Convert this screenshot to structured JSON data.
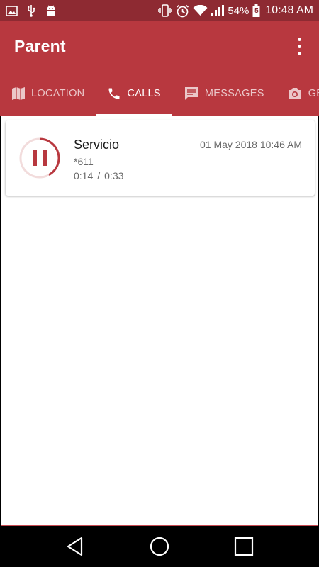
{
  "status_bar": {
    "battery": "54%",
    "time": "10:48 AM",
    "battery_digit": "5",
    "icons": [
      "image-icon",
      "usb-icon",
      "android-debug-icon",
      "vibrate-icon",
      "alarm-icon",
      "wifi-icon",
      "signal-icon",
      "battery-icon"
    ]
  },
  "app_bar": {
    "title": "Parent",
    "menu_icon": "more-vert-icon"
  },
  "tabs": [
    {
      "label": "LOCATION",
      "icon": "map-icon",
      "active": false
    },
    {
      "label": "CALLS",
      "icon": "phone-icon",
      "active": true
    },
    {
      "label": "MESSAGES",
      "icon": "message-icon",
      "active": false
    },
    {
      "label": "GET",
      "icon": "camera-icon",
      "active": false
    }
  ],
  "calls": [
    {
      "name": "Servicio",
      "number": "*611",
      "datetime": "01 May 2018 10:46 AM",
      "elapsed": "0:14",
      "separator": "/",
      "duration": "0:33",
      "progress_fraction": 0.42,
      "control_icon": "pause-icon"
    }
  ],
  "colors": {
    "status_bar": "#8e2a32",
    "primary": "#b8383f",
    "accent": "#b8383f",
    "progress_track": "#f2dcdc"
  },
  "nav_bar": {
    "icons": [
      "back-icon",
      "home-icon",
      "recents-icon"
    ]
  }
}
